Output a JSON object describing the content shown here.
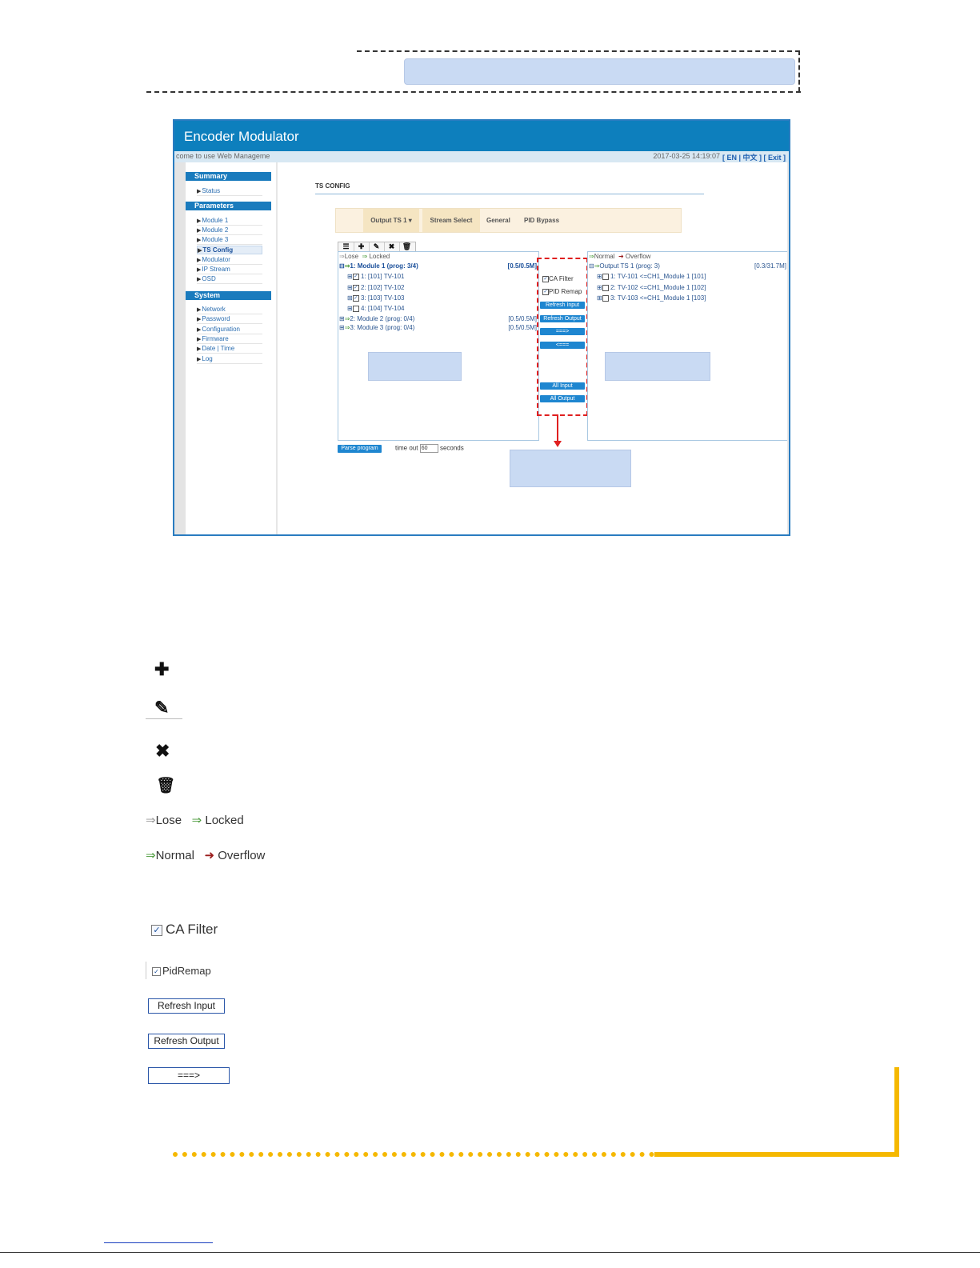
{
  "app": {
    "title": "Encoder Modulator",
    "welcome": "come to use Web Manageme",
    "datetime": "2017-03-25 14:19:07",
    "language_links": "[ EN | 中文 ]  [ Exit ]"
  },
  "sidebar": {
    "summary_header": "Summary",
    "summary_items": [
      "Status"
    ],
    "parameters_header": "Parameters",
    "parameters_items": [
      "Module 1",
      "Module 2",
      "Module 3",
      "TS Config",
      "Modulator",
      "IP Stream",
      "OSD"
    ],
    "system_header": "System",
    "system_items": [
      "Network",
      "Password",
      "Configuration",
      "Firmware",
      "Date | Time",
      "Log"
    ]
  },
  "main": {
    "section_title": "TS CONFIG",
    "tabs": [
      "Output TS 1 ▾",
      "Stream Select",
      "General",
      "PID Bypass"
    ],
    "toolbar_icons": [
      "list-icon",
      "plus-icon",
      "pencil-icon",
      "close-icon",
      "trash-icon"
    ]
  },
  "input_panel": {
    "legend_lose": "Lose",
    "legend_locked": "Locked",
    "rows": [
      {
        "text": "1: Module 1 (prog: 3/4)",
        "rate": "[0.5/0.5M]"
      },
      {
        "text": "1: [101] TV-101"
      },
      {
        "text": "2: [102] TV-102"
      },
      {
        "text": "3: [103] TV-103"
      },
      {
        "text": "4: [104] TV-104"
      },
      {
        "text": "2: Module 2 (prog: 0/4)",
        "rate": "[0.5/0.5M]"
      },
      {
        "text": "3: Module 3 (prog: 0/4)",
        "rate": "[0.5/0.5M]"
      }
    ]
  },
  "output_panel": {
    "legend_normal": "Normal",
    "legend_overflow": "Overflow",
    "root": "Output TS 1 (prog: 3)",
    "root_rate": "[0.3/31.7M]",
    "rows": [
      "1: TV-101 <=CH1_Module 1 [101]",
      "2: TV-102 <=CH1_Module 1 [102]",
      "3: TV-103 <=CH1_Module 1 [103]"
    ]
  },
  "middle_controls": {
    "ca_filter": "CA Filter",
    "pid_remap": "PID Remap",
    "refresh_input": "Refresh Input",
    "refresh_output": "Refresh Output",
    "add_arrow": "===>",
    "remove_arrow": "<===",
    "all_input": "All Input",
    "all_output": "All Output"
  },
  "bottom_controls": {
    "parse_program": "Parse program",
    "timeout_label": "time out",
    "timeout_value": "60",
    "timeout_unit": "seconds"
  },
  "legend_list": {
    "lose": "Lose",
    "locked": "Locked",
    "normal": "Normal",
    "overflow": "Overflow",
    "ca_filter": "CA Filter",
    "pid_remap": "PidRemap",
    "refresh_input": "Refresh Input",
    "refresh_output": "Refresh Output",
    "arrow": "===>"
  },
  "colors": {
    "brand_blue": "#0d7fbd",
    "button_blue": "#1e86d0",
    "highlight_red": "#e02020",
    "accent_yellow": "#f5b800",
    "placeholder_blue": "#c9daf3"
  }
}
